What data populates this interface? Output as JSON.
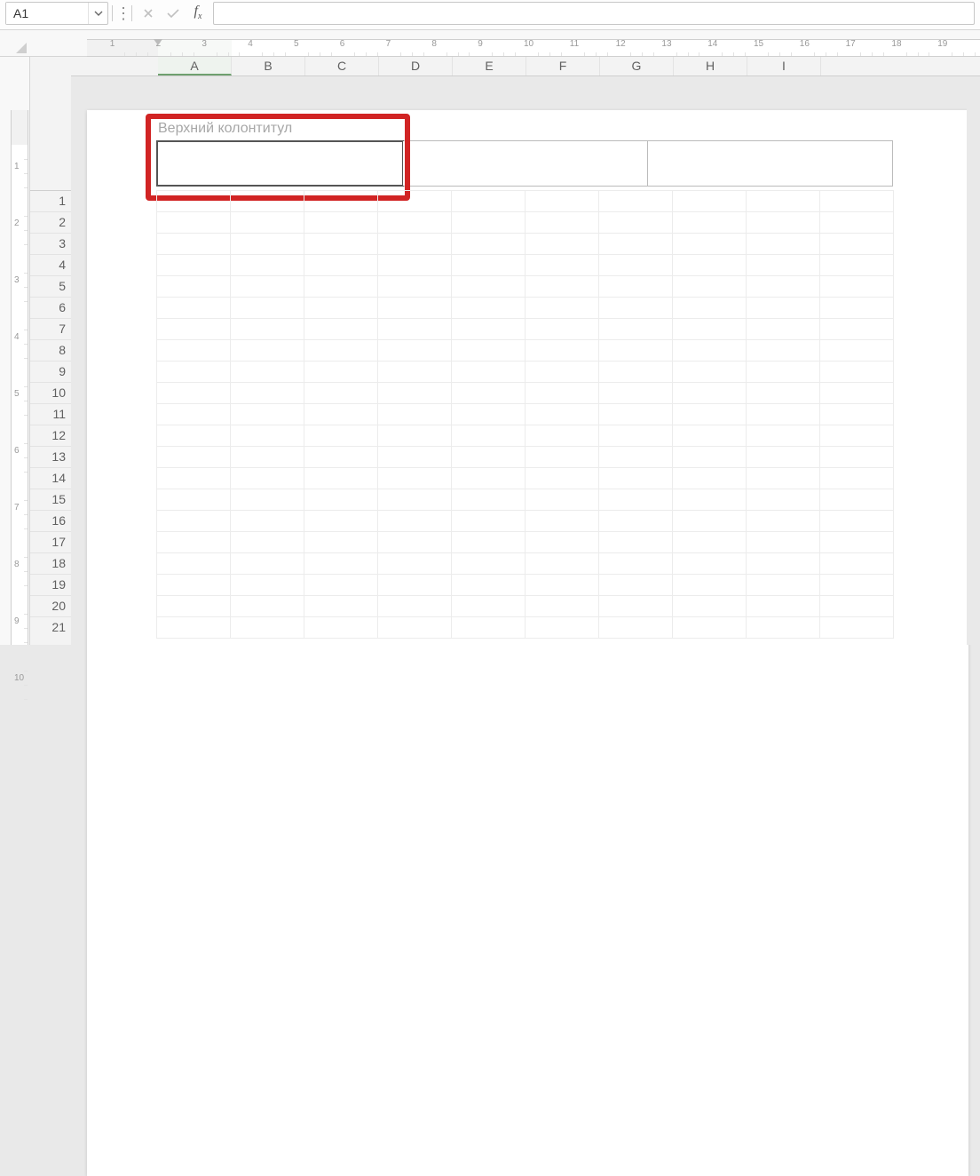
{
  "nameBox": {
    "value": "A1"
  },
  "formula": {
    "value": ""
  },
  "columns": [
    "A",
    "B",
    "C",
    "D",
    "E",
    "F",
    "G",
    "H",
    "I"
  ],
  "activeColumn": "A",
  "rowCount": 21,
  "rulerMax": 19,
  "vRulerMax": 10,
  "header": {
    "label": "Верхний колонтитул",
    "segments": [
      "",
      "",
      ""
    ]
  }
}
